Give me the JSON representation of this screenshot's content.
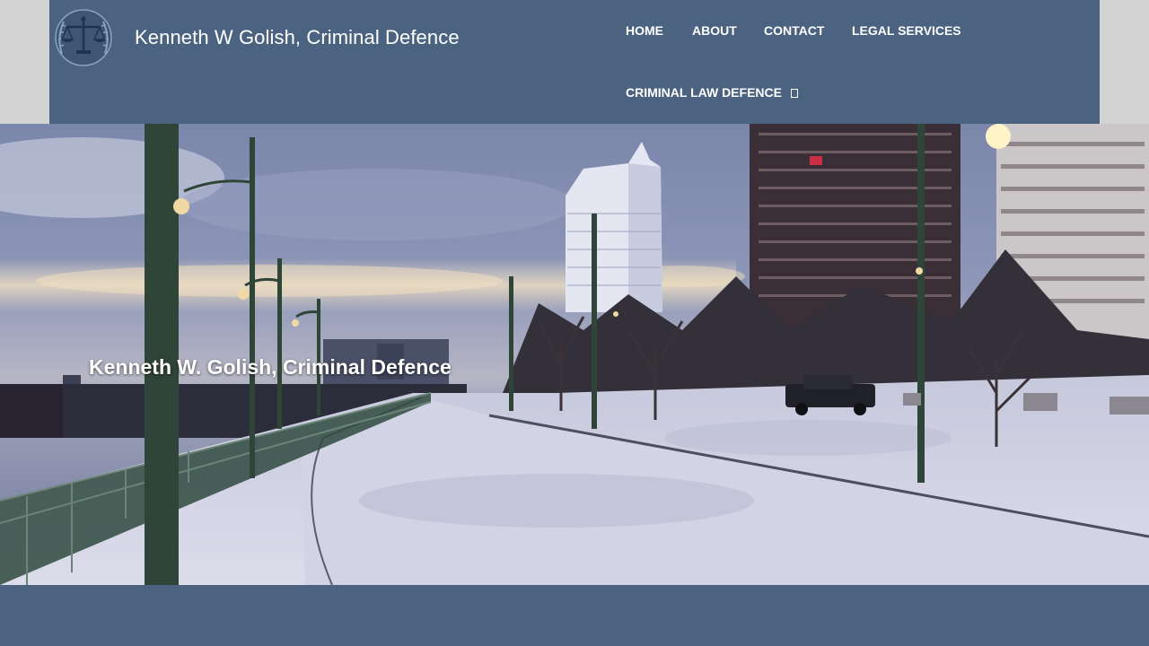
{
  "header": {
    "site_title": "Kenneth W Golish, Criminal Defence",
    "logo_icon": "scales-of-justice-icon",
    "background_color": "#4b6380"
  },
  "nav": {
    "items": [
      {
        "label": "HOME"
      },
      {
        "label": "ABOUT"
      },
      {
        "label": "CONTACT"
      },
      {
        "label": "LEGAL SERVICES"
      },
      {
        "label": "CRIMINAL LAW DEFENCE",
        "icon": "dropdown-icon"
      }
    ]
  },
  "hero": {
    "title": "Kenneth W. Golish, Criminal Defence",
    "image": "snowy-waterfront-promenade-photo"
  },
  "colors": {
    "header_band": "#4b6380",
    "page_side": "#d3d3d3",
    "text": "#ffffff"
  }
}
